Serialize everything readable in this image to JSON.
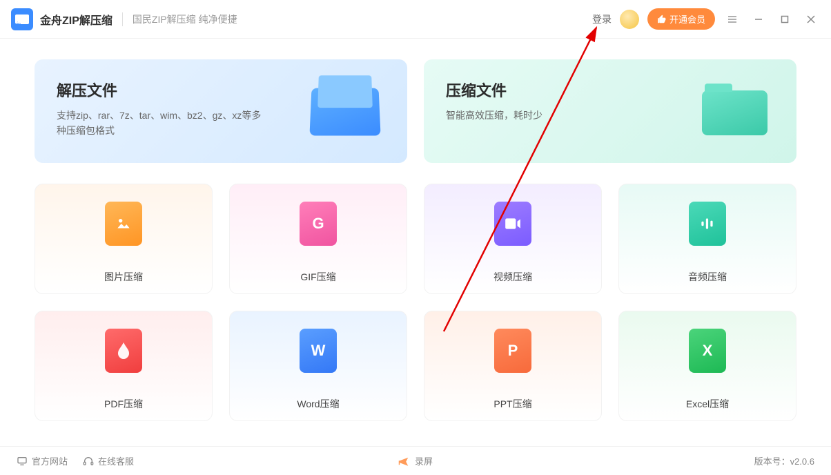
{
  "header": {
    "app_title": "金舟ZIP解压缩",
    "app_subtitle": "国民ZIP解压缩 纯净便捷",
    "login": "登录",
    "vip_label": "开通会员"
  },
  "hero": {
    "decompress": {
      "title": "解压文件",
      "desc": "支持zip、rar、7z、tar、wim、bz2、gz、xz等多种压缩包格式"
    },
    "compress": {
      "title": "压缩文件",
      "desc": "智能高效压缩，耗时少"
    }
  },
  "cards": {
    "image": "图片压缩",
    "gif": "GIF压缩",
    "video": "视频压缩",
    "audio": "音频压缩",
    "pdf": "PDF压缩",
    "word": "Word压缩",
    "ppt": "PPT压缩",
    "excel": "Excel压缩"
  },
  "footer": {
    "website": "官方网站",
    "support": "在线客服",
    "record": "录屏",
    "version_label": "版本号：",
    "version": "v2.0.6"
  },
  "icons": {
    "thumb": "👍",
    "gif_letter": "G",
    "word_letter": "W",
    "ppt_letter": "P",
    "excel_letter": "X"
  }
}
